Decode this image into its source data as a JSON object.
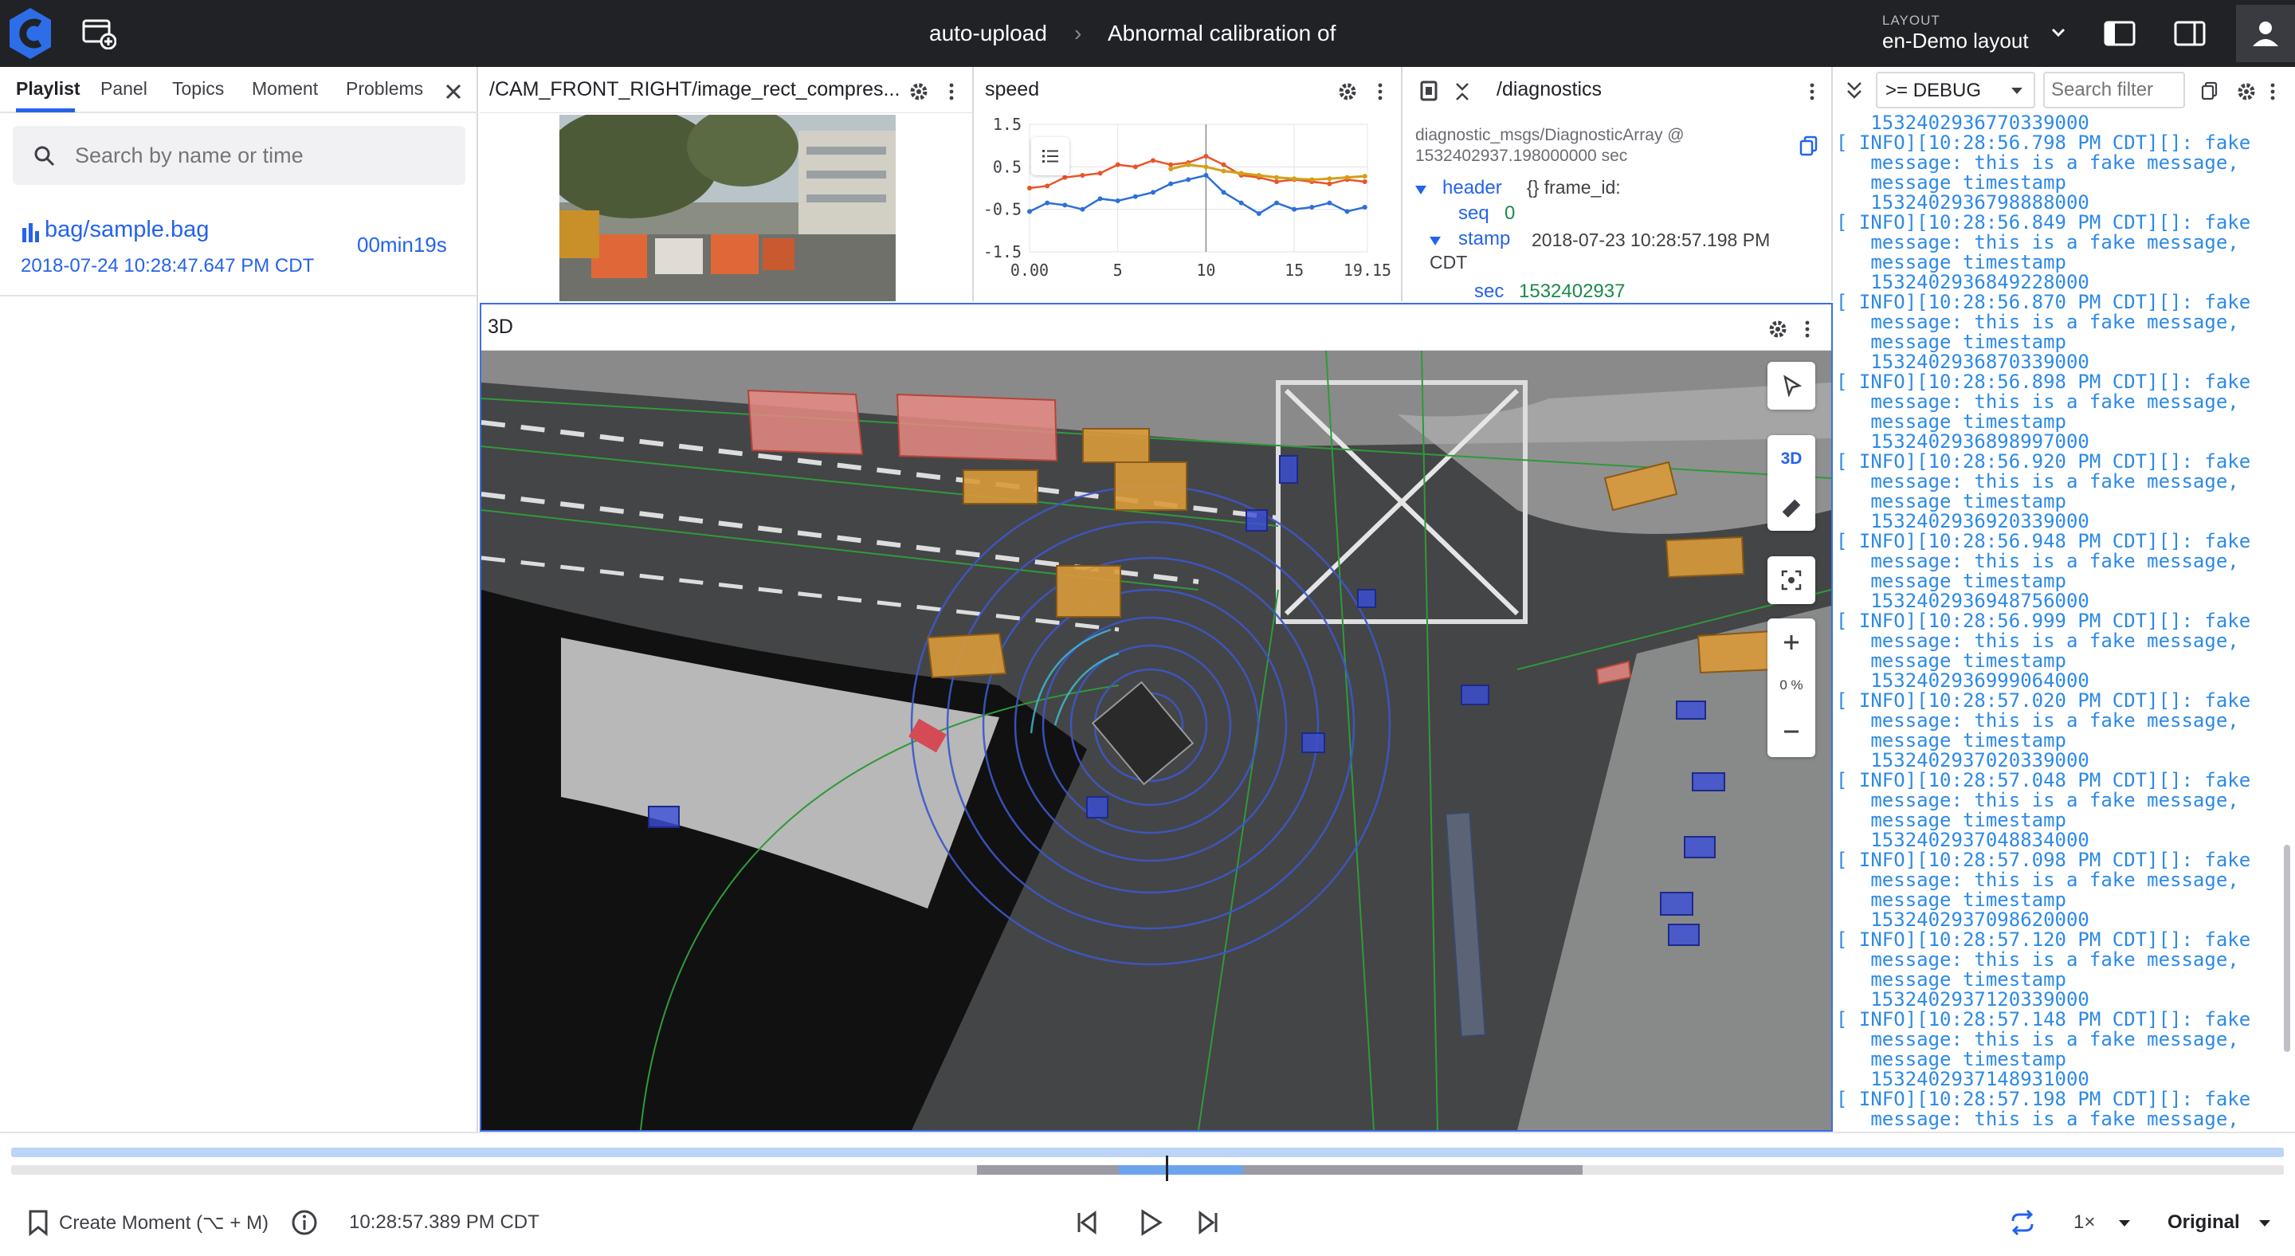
{
  "topbar": {
    "breadcrumb_source": "auto-upload",
    "breadcrumb_sep": "›",
    "breadcrumb_event": "Abnormal calibration of",
    "layout_label": "LAYOUT",
    "layout_value": "en-Demo layout"
  },
  "sidebar": {
    "tabs": [
      "Playlist",
      "Panel",
      "Topics",
      "Moment",
      "Problems"
    ],
    "search_placeholder": "Search by name or time",
    "bag": {
      "name": "bag/sample.bag",
      "date": "2018-07-24 10:28:47.647 PM CDT",
      "duration": "00min19s"
    }
  },
  "camera_panel": {
    "title": "/CAM_FRONT_RIGHT/image_rect_compres..."
  },
  "speed_panel": {
    "title": "speed",
    "chart_data": {
      "type": "line",
      "title": "",
      "xlabel": "",
      "ylabel": "",
      "xlim": [
        0,
        19.15
      ],
      "ylim": [
        -1.5,
        1.5
      ],
      "x_ticks": [
        "0.00",
        "5",
        "10",
        "15",
        "19.15"
      ],
      "y_ticks": [
        "1.5",
        "0.5",
        "-0.5",
        "-1.5"
      ],
      "series": [
        {
          "color": "#e8542a",
          "x": [
            0,
            1,
            2,
            3,
            4,
            5,
            6,
            7,
            8,
            9,
            10,
            11,
            12,
            13,
            14,
            15,
            16,
            17,
            18,
            19
          ],
          "y": [
            0.0,
            0.05,
            0.25,
            0.3,
            0.35,
            0.55,
            0.5,
            0.65,
            0.55,
            0.6,
            0.75,
            0.55,
            0.3,
            0.25,
            0.15,
            0.2,
            0.15,
            0.1,
            0.2,
            0.15
          ]
        },
        {
          "color": "#2f6fd6",
          "x": [
            0,
            1,
            2,
            3,
            4,
            5,
            6,
            7,
            8,
            9,
            10,
            11,
            12,
            13,
            14,
            15,
            16,
            17,
            18,
            19
          ],
          "y": [
            -0.55,
            -0.35,
            -0.4,
            -0.5,
            -0.25,
            -0.3,
            -0.2,
            -0.1,
            0.1,
            0.2,
            0.3,
            -0.1,
            -0.35,
            -0.6,
            -0.35,
            -0.5,
            -0.45,
            -0.35,
            -0.55,
            -0.45
          ]
        },
        {
          "color": "#d4a017",
          "x": [
            8,
            9,
            10,
            11,
            12,
            13,
            14,
            15,
            16,
            17,
            18,
            19
          ],
          "y": [
            0.45,
            0.55,
            0.5,
            0.4,
            0.35,
            0.3,
            0.25,
            0.22,
            0.2,
            0.22,
            0.25,
            0.28
          ]
        }
      ]
    }
  },
  "diagnostics_panel": {
    "title": "/diagnostics",
    "type_line": "diagnostic_msgs/DiagnosticArray @",
    "time_line": "1532402937.198000000 sec",
    "header_key": "header",
    "header_val": "{} frame_id:",
    "seq_key": "seq",
    "seq_val": "0",
    "stamp_key": "stamp",
    "stamp_val": "2018-07-23 10:28:57.198 PM",
    "stamp_tz": "CDT",
    "sec_key": "sec",
    "sec_val": "1532402937"
  },
  "scene_panel": {
    "title": "3D",
    "mode_label": "3D",
    "zoom_label": "0 %"
  },
  "log_panel": {
    "level": ">= DEBUG",
    "filter_placeholder": "Search filter",
    "lines": [
      "   1532402936770339000",
      "[ INFO][10:28:56.798 PM CDT][]: fake",
      "   message: this is a fake message,",
      "   message timestamp",
      "   1532402936798888000",
      "[ INFO][10:28:56.849 PM CDT][]: fake",
      "   message: this is a fake message,",
      "   message timestamp",
      "   1532402936849228000",
      "[ INFO][10:28:56.870 PM CDT][]: fake",
      "   message: this is a fake message,",
      "   message timestamp",
      "   1532402936870339000",
      "[ INFO][10:28:56.898 PM CDT][]: fake",
      "   message: this is a fake message,",
      "   message timestamp",
      "   1532402936898997000",
      "[ INFO][10:28:56.920 PM CDT][]: fake",
      "   message: this is a fake message,",
      "   message timestamp",
      "   1532402936920339000",
      "[ INFO][10:28:56.948 PM CDT][]: fake",
      "   message: this is a fake message,",
      "   message timestamp",
      "   1532402936948756000",
      "[ INFO][10:28:56.999 PM CDT][]: fake",
      "   message: this is a fake message,",
      "   message timestamp",
      "   1532402936999064000",
      "[ INFO][10:28:57.020 PM CDT][]: fake",
      "   message: this is a fake message,",
      "   message timestamp",
      "   1532402937020339000",
      "[ INFO][10:28:57.048 PM CDT][]: fake",
      "   message: this is a fake message,",
      "   message timestamp",
      "   1532402937048834000",
      "[ INFO][10:28:57.098 PM CDT][]: fake",
      "   message: this is a fake message,",
      "   message timestamp",
      "   1532402937098620000",
      "[ INFO][10:28:57.120 PM CDT][]: fake",
      "   message: this is a fake message,",
      "   message timestamp",
      "   1532402937120339000",
      "[ INFO][10:28:57.148 PM CDT][]: fake",
      "   message: this is a fake message,",
      "   message timestamp",
      "   1532402937148931000",
      "[ INFO][10:28:57.198 PM CDT][]: fake",
      "   message: this is a fake message,"
    ]
  },
  "playback": {
    "create_moment": "Create Moment (⌥ + M)",
    "current_time": "10:28:57.389 PM CDT",
    "speed": "1×",
    "time_format": "Original"
  },
  "colors": {
    "accent": "#2563eb",
    "topbar_bg": "#212226",
    "log_text": "#2d8ae6"
  }
}
